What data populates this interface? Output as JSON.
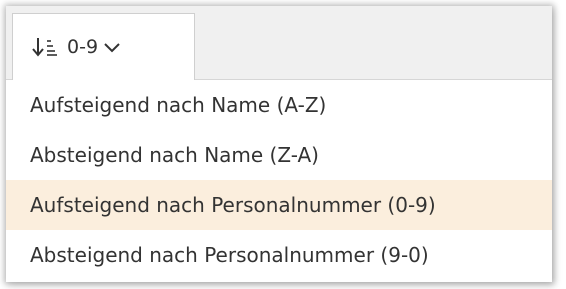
{
  "sort_button": {
    "label": "0-9",
    "icon": "sort-ascending-icon",
    "chevron": "chevron-down-icon"
  },
  "menu": {
    "items": [
      {
        "label": "Aufsteigend nach Name (A-Z)",
        "selected": false
      },
      {
        "label": "Absteigend nach Name (Z-A)",
        "selected": false
      },
      {
        "label": "Aufsteigend nach Personalnummer (0-9)",
        "selected": true
      },
      {
        "label": "Absteigend nach Personalnummer (9-0)",
        "selected": false
      }
    ]
  },
  "colors": {
    "selected_background": "#fbeedd",
    "text": "#333333",
    "strip_background": "#f0f0f0"
  }
}
